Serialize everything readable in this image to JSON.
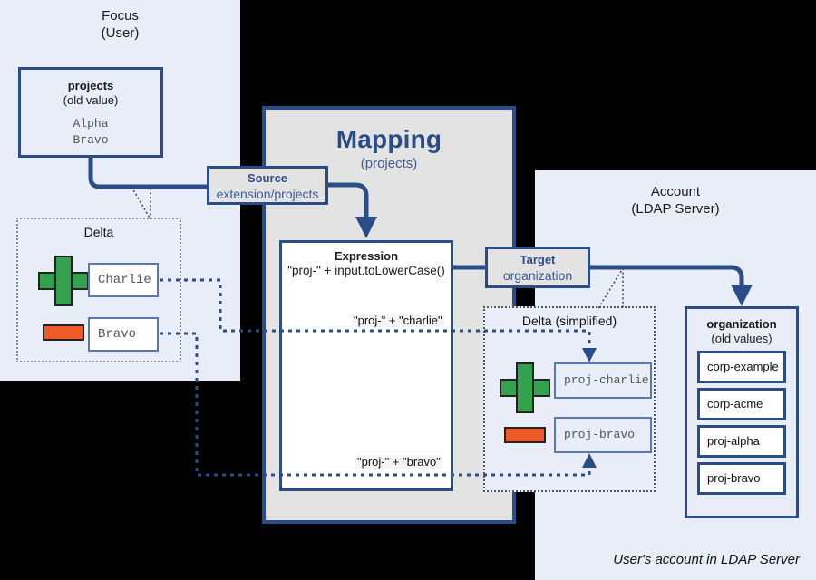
{
  "focus": {
    "title_line1": "Focus",
    "title_line2": "(User)",
    "projects_box": {
      "header": "projects",
      "subheader": "(old value)",
      "values": [
        "Alpha",
        "Bravo"
      ]
    },
    "delta": {
      "title": "Delta",
      "items": [
        {
          "op": "plus-icon",
          "value": "Charlie"
        },
        {
          "op": "minus-icon",
          "value": "Bravo"
        }
      ]
    }
  },
  "mapping": {
    "title": "Mapping",
    "subtitle": "(projects)",
    "source": {
      "label": "Source",
      "value": "extension/projects"
    },
    "target": {
      "label": "Target",
      "value": "organization"
    },
    "expression": {
      "header": "Expression",
      "formula": "\"proj-\" + input.toLowerCase()",
      "trace_top": "\"proj-\" + \"charlie\"",
      "trace_bottom": "\"proj-\" + \"bravo\""
    }
  },
  "account": {
    "title_line1": "Account",
    "title_line2": "(LDAP Server)",
    "footer": "User's account in LDAP Server",
    "delta": {
      "title": "Delta (simplified)",
      "items": [
        {
          "op": "plus-icon",
          "value": "proj-charlie"
        },
        {
          "op": "minus-icon",
          "value": "proj-bravo"
        }
      ]
    },
    "organization_box": {
      "header": "organization",
      "subheader": "(old values)",
      "values": [
        "corp-example",
        "corp-acme",
        "proj-alpha",
        "proj-bravo"
      ]
    }
  },
  "colors": {
    "panel_blue": "#e8edf8",
    "mapping_gray": "#e3e3e3",
    "accent_navy": "#2a4d87",
    "add_green": "#34a14e",
    "remove_orange": "#f05a28",
    "background": "#000000"
  }
}
